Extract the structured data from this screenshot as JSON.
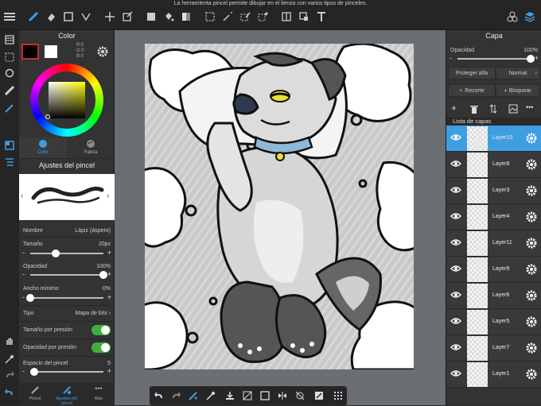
{
  "topbar": {
    "hint": "La herramienta pincel permite dibujar en el lienzo con varios tipos de pinceles."
  },
  "color_panel": {
    "title": "Color",
    "rgb": {
      "r": "R:0",
      "g": "G:0",
      "b": "B:0"
    },
    "tabs": [
      {
        "label": "Color"
      },
      {
        "label": "Paleta"
      }
    ]
  },
  "brush_panel": {
    "title": "Ajustes del pincel",
    "name_label": "Nombre",
    "name_value": "Lápiz (áspero)",
    "size_label": "Tamaño",
    "size_value": "20px",
    "size_level": 0.35,
    "opacity_label": "Opacidad",
    "opacity_value": "100%",
    "opacity_level": 1.0,
    "min_width_label": "Ancho mínimo",
    "min_width_value": "0%",
    "min_width_level": 0.0,
    "type_label": "Tipo",
    "type_value": "Mapa de bits",
    "size_pressure_label": "Tamaño por presión",
    "opacity_pressure_label": "Opacidad por presión",
    "spacing_label": "Espacio del pincel",
    "spacing_value": "5",
    "spacing_level": 0.05,
    "bottom_tabs": [
      {
        "label": "Pincel"
      },
      {
        "label": "Ajustes del pincel"
      },
      {
        "label": "Más"
      }
    ]
  },
  "layer_panel": {
    "title": "Capa",
    "opacity_label": "Opacidad",
    "opacity_value": "100%",
    "opacity_level": 1.0,
    "protect_alpha": "Proteger alfa",
    "blend_mode": "Normal",
    "clipping": "Recorte",
    "lock": "Bloquear",
    "list_title": "Lista de capas",
    "layers": [
      {
        "name": "Layer10",
        "selected": true
      },
      {
        "name": "Layer8"
      },
      {
        "name": "Layer3"
      },
      {
        "name": "Layer4"
      },
      {
        "name": "Layer11"
      },
      {
        "name": "Layer9"
      },
      {
        "name": "Layer6"
      },
      {
        "name": "Layer5"
      },
      {
        "name": "Layer7"
      },
      {
        "name": "Layer1"
      }
    ]
  },
  "colors": {
    "accent": "#3f9ee0",
    "toggle_on": "#3fae3f",
    "foreground": "#000000",
    "background": "#ffffff"
  }
}
